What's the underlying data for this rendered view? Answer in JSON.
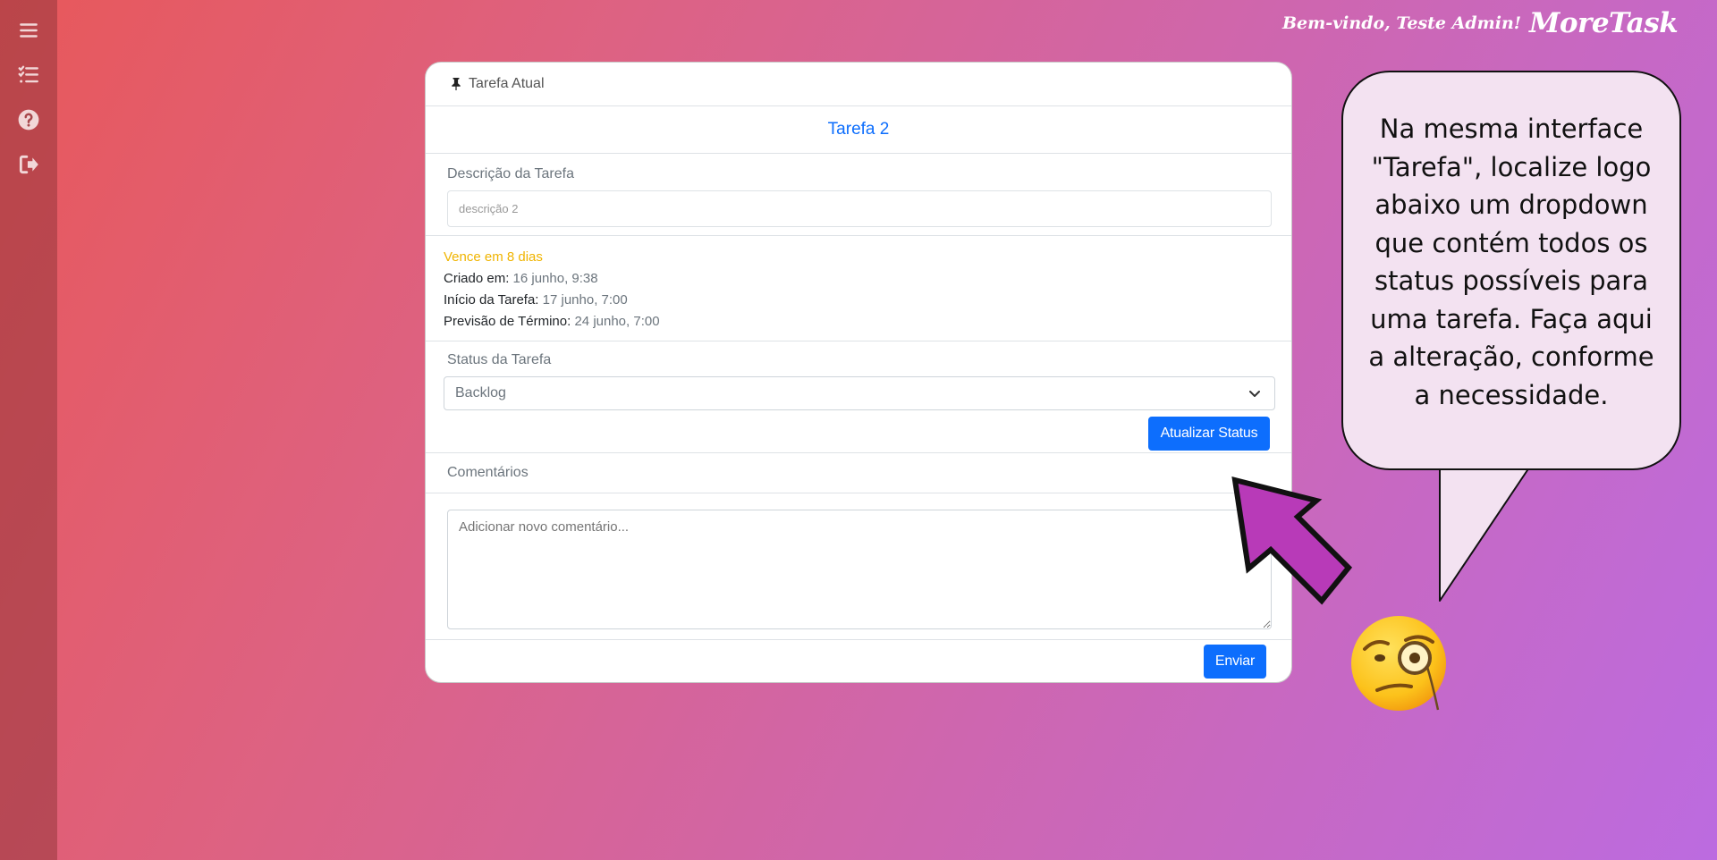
{
  "header": {
    "welcome": "Bem-vindo, Teste Admin!",
    "brand": "MoreTask"
  },
  "sidebar": {
    "items": [
      {
        "icon": "menu-icon"
      },
      {
        "icon": "task-list-icon"
      },
      {
        "icon": "help-icon"
      },
      {
        "icon": "logout-icon"
      }
    ]
  },
  "card": {
    "header_label": "Tarefa Atual",
    "task_title": "Tarefa 2",
    "description_label": "Descrição da Tarefa",
    "description_value": "descrição 2",
    "due": "Vence em 8 dias",
    "created_label": "Criado em:",
    "created_value": "16 junho, 9:38",
    "start_label": "Início da Tarefa:",
    "start_value": "17 junho, 7:00",
    "end_label": "Previsão de Término:",
    "end_value": "24 junho, 7:00",
    "status_label": "Status da Tarefa",
    "status_selected": "Backlog",
    "update_button": "Atualizar Status",
    "comments_label": "Comentários",
    "comment_placeholder": "Adicionar novo comentário...",
    "send_button": "Enviar"
  },
  "annotation": {
    "bubble_text": "Na mesma interface \"Tarefa\", localize logo abaixo um dropdown que contém todos os status possíveis para uma tarefa. Faça aqui a alteração, conforme a necessidade.",
    "arrow_color": "#b83ab8",
    "emoji": "face-with-monocle"
  },
  "colors": {
    "primary": "#0d6efd",
    "due_warning": "#f0b400"
  }
}
